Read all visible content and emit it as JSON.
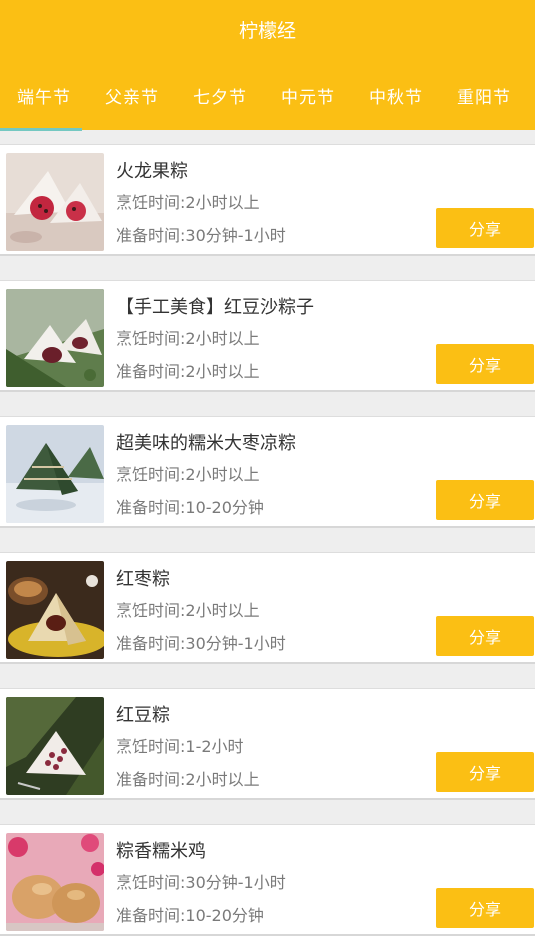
{
  "app": {
    "title": "柠檬经"
  },
  "tabs": [
    "端午节",
    "父亲节",
    "七夕节",
    "中元节",
    "中秋节",
    "重阳节"
  ],
  "active_tab_index": 0,
  "recipes": [
    {
      "name": "火龙果粽",
      "cook_time": "烹饪时间:2小时以上",
      "prep_time": "准备时间:30分钟-1小时",
      "share_label": "分享"
    },
    {
      "name": "【手工美食】红豆沙粽子",
      "cook_time": "烹饪时间:2小时以上",
      "prep_time": "准备时间:2小时以上",
      "share_label": "分享"
    },
    {
      "name": "超美味的糯米大枣凉粽",
      "cook_time": "烹饪时间:2小时以上",
      "prep_time": "准备时间:10-20分钟",
      "share_label": "分享"
    },
    {
      "name": "红枣粽",
      "cook_time": "烹饪时间:2小时以上",
      "prep_time": "准备时间:30分钟-1小时",
      "share_label": "分享"
    },
    {
      "name": "红豆粽",
      "cook_time": "烹饪时间:1-2小时",
      "prep_time": "准备时间:2小时以上",
      "share_label": "分享"
    },
    {
      "name": "粽香糯米鸡",
      "cook_time": "烹饪时间:30分钟-1小时",
      "prep_time": "准备时间:10-20分钟",
      "share_label": "分享"
    }
  ],
  "colors": {
    "accent": "#fbbf14",
    "tab_indicator": "#74c8c2",
    "background": "#eeeeee"
  }
}
